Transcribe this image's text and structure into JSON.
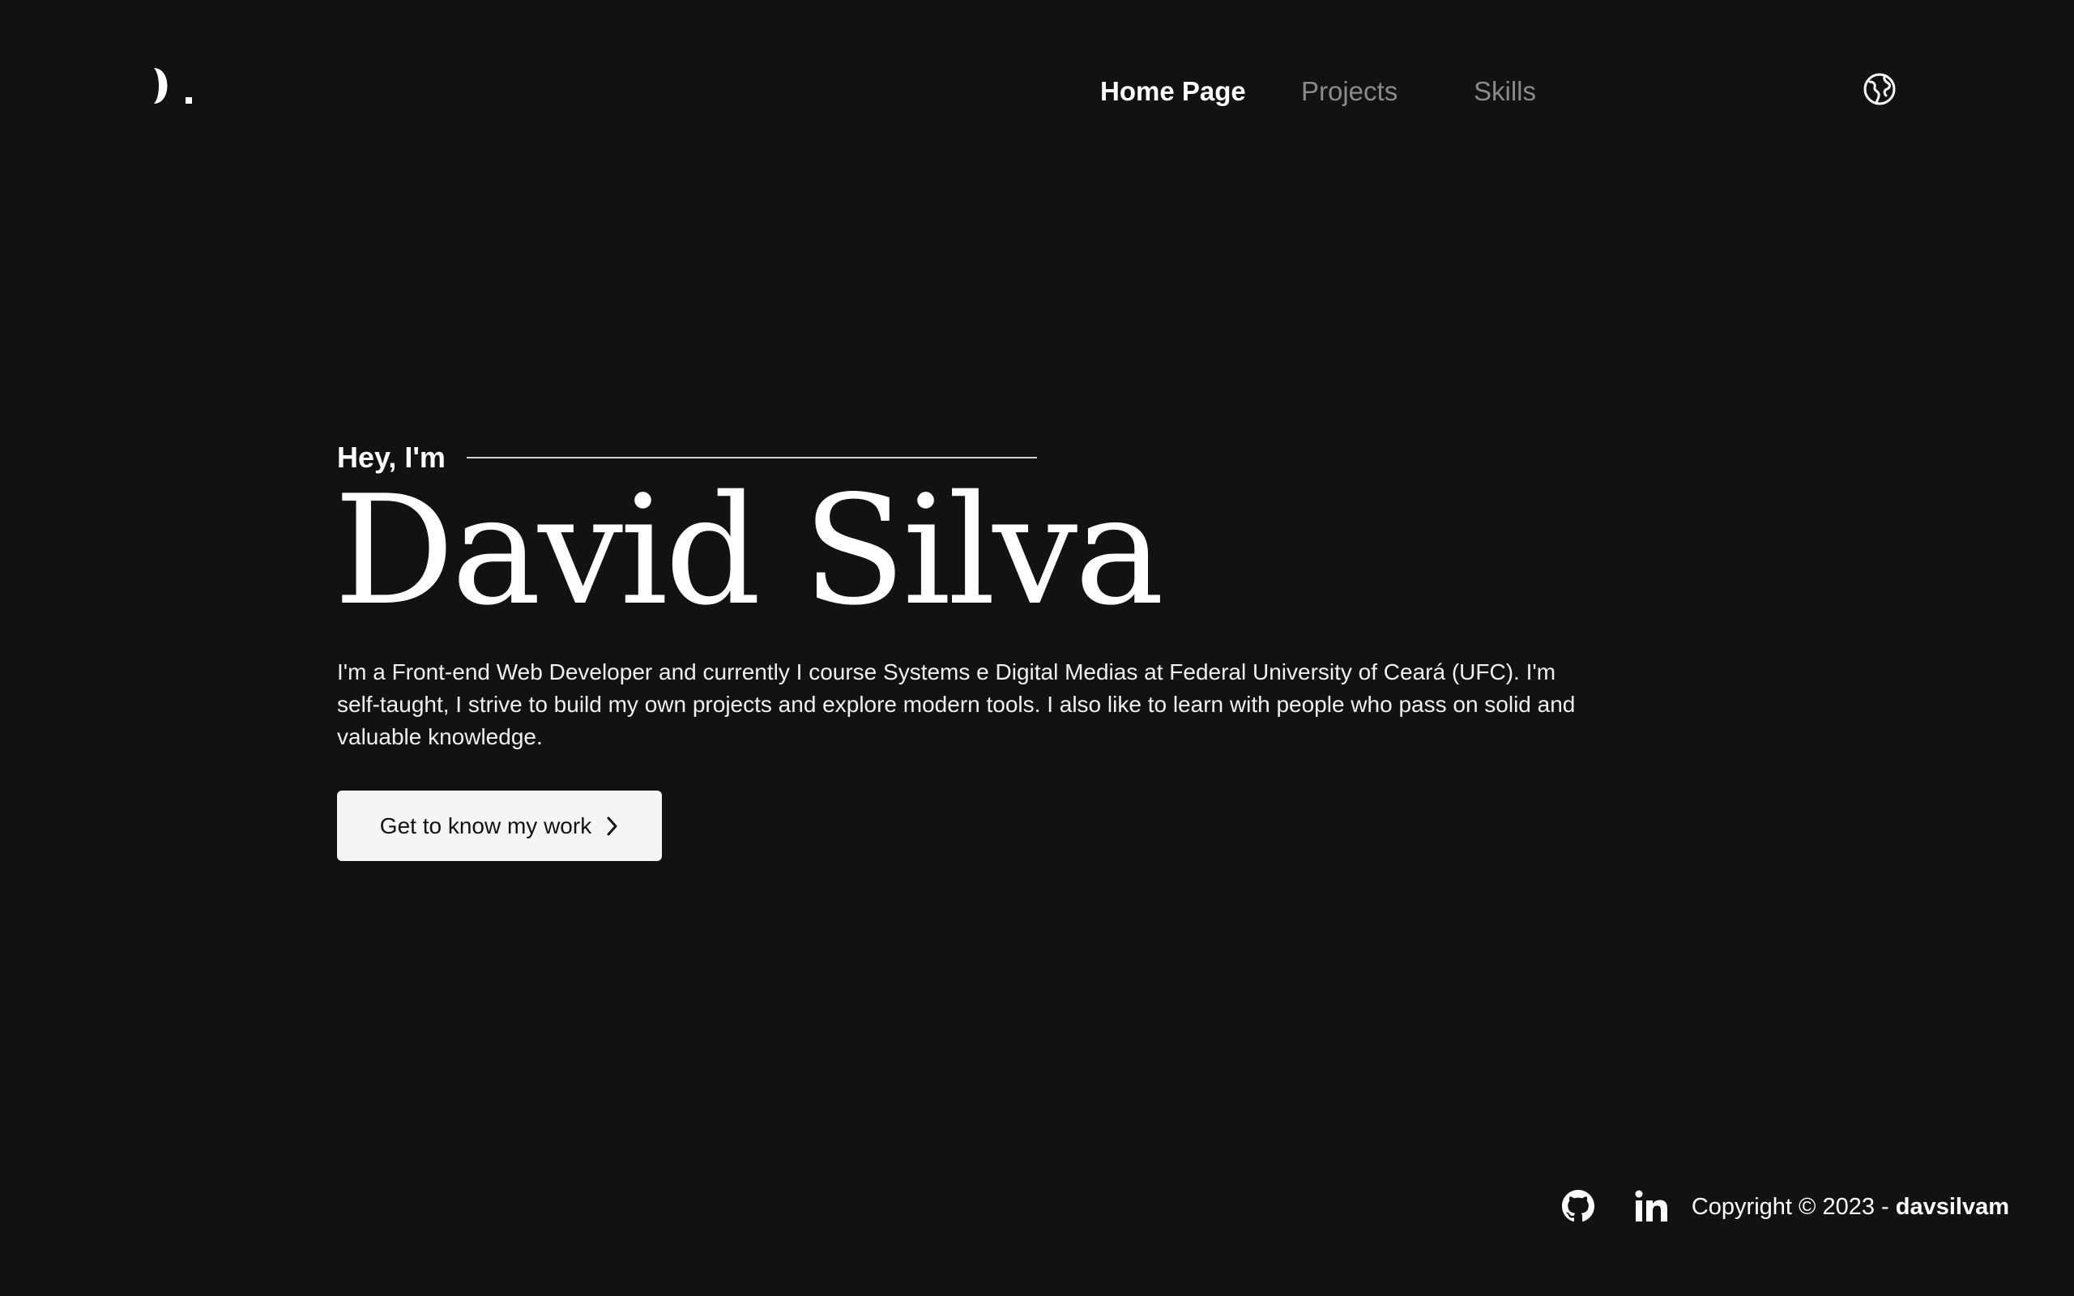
{
  "header": {
    "logo_icon": "dm-logo-icon",
    "nav": {
      "home": "Home Page",
      "projects": "Projects",
      "skills": "Skills"
    },
    "language_icon": "globe-icon"
  },
  "hero": {
    "intro": "Hey, I'm",
    "name": "David Silva",
    "bio": "I'm a Front-end Web Developer and currently I course Systems e Digital Medias at Federal University of Ceará (UFC). I'm self-taught, I strive to build my own projects and explore modern tools. I also like to learn with people who pass on solid and valuable knowledge.",
    "cta_label": "Get to know my work",
    "cta_icon": "chevron-right-icon"
  },
  "footer": {
    "github_icon": "github-icon",
    "linkedin_icon": "linkedin-icon",
    "copyright_prefix": "Copyright © 2023 - ",
    "copyright_handle": "davsilvam"
  },
  "colors": {
    "background": "#121212",
    "text_primary": "#ffffff",
    "text_muted": "#8a8a8a",
    "button_bg": "#f5f5f5",
    "button_text": "#121212"
  }
}
